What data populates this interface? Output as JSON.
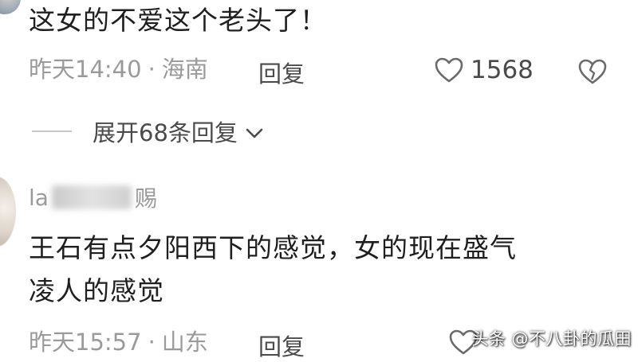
{
  "comment1": {
    "text": "这女的不爱这个老头了！",
    "time": "昨天14:40",
    "location": "海南",
    "reply_label": "回复",
    "like_count": "1568",
    "expand_label": "展开68条回复"
  },
  "comment2": {
    "username_prefix": "la",
    "username_suffix": "赐",
    "text_line1": "王石有点夕阳西下的感觉，女的现在盛气",
    "text_line2": "凌人的感觉",
    "time": "昨天15:57",
    "location": "山东",
    "reply_label": "回复"
  },
  "meta_separator": "·",
  "watermark": "头条 @不八卦的瓜田",
  "icons": {
    "like": "heart-outline-icon",
    "dislike": "broken-heart-icon",
    "expand": "chevron-down-icon"
  },
  "colors": {
    "text": "#1f1f1f",
    "meta": "#9a9a9a",
    "action": "#4a4a4a"
  }
}
